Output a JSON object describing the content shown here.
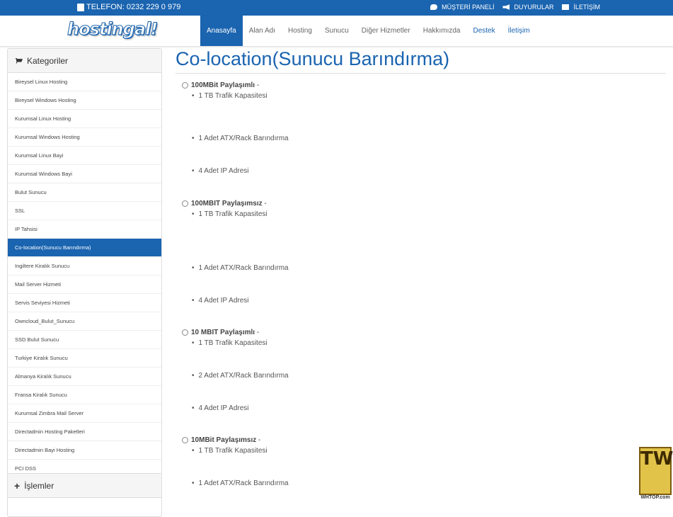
{
  "topbar": {
    "phone": "TELEFON: 0232 229 0 979",
    "links": [
      "MÜŞTERİ PANELİ",
      "DUYURULAR",
      "İLETİŞİM"
    ]
  },
  "logo": "hostingal!",
  "nav": [
    "Anasayfa",
    "Alan Adı",
    "Hosting",
    "Sunucu",
    "Diğer Hizmetler",
    "Hakkımızda",
    "Destek",
    "İletişim"
  ],
  "sidebar": {
    "categories_title": "Kategoriler",
    "items": [
      "Bireysel Linux Hosting",
      "Bireysel Windows Hosting",
      "Kurumsal Linux Hosting",
      "Kurumsal Windows Hosting",
      "Kurumsal Linux Bayi",
      "Kurumsal Windows Bayi",
      "Bulut Sunucu",
      "SSL",
      "IP Tahsisi",
      "Co-location(Sunucu Barındırma)",
      "Ingiltere Kiralık Sunucu",
      "Mail Server Hizmeti",
      "Servis Seviyesi Hizmeti",
      "Owncloud_Bulut_Sunucu",
      "SSD Bulut Sunucu",
      "Turkiye Kiralık Sunucu",
      "Almanya Kiralık Sunucu",
      "Fransa Kiralık Sunucu",
      "Kurumsal Zimbra Mail Server",
      "Directadmin Hosting Paketleri",
      "Directadmin Bayi Hosting",
      "PCI DSS"
    ],
    "active_index": 9,
    "actions_title": "İşlemler"
  },
  "main": {
    "title": "Co-location(Sunucu Barındırma)",
    "products": [
      {
        "name": "100MBit Paylaşımlı",
        "suffix": " -",
        "features": [
          "1 TB Trafik Kapasitesi",
          "1 Adet ATX/Rack Barındırma",
          "4 Adet IP Adresi"
        ]
      },
      {
        "name": "100MBIT Paylaşımsız",
        "suffix": " -",
        "features": [
          "1 TB Trafik Kapasitesi",
          "1 Adet ATX/Rack Barındırma",
          "4 Adet IP Adresi"
        ]
      },
      {
        "name": "10 MBIT Paylaşımlı",
        "suffix": " -",
        "features": [
          "1 TB Trafik Kapasitesi",
          "2 Adet ATX/Rack Barındırma",
          "4 Adet IP Adresi"
        ]
      },
      {
        "name": "10MBit Paylaşımsız",
        "suffix": " -",
        "features": [
          "1 TB Trafik Kapasitesi",
          "1 Adet ATX/Rack Barındırma"
        ]
      }
    ]
  },
  "watermark": {
    "logo": "TW",
    "caption": "WHTOP.com"
  },
  "colors": {
    "primary": "#1a64b0",
    "topbar": "#1a64b0"
  }
}
